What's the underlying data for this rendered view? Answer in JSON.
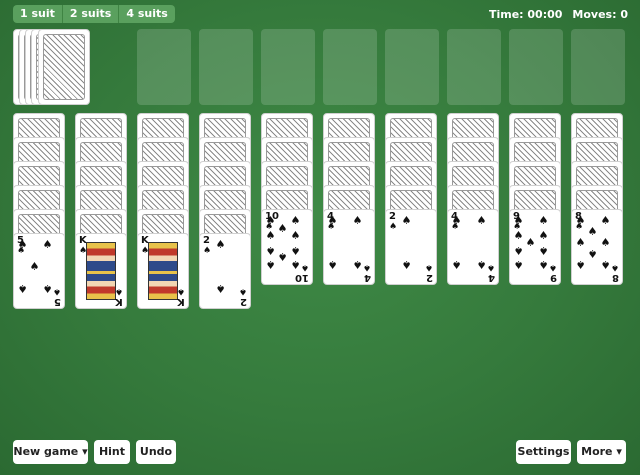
{
  "suits": {
    "one": "1 suit",
    "two": "2 suits",
    "four": "4 suits"
  },
  "status": {
    "time": "Time: 00:00",
    "moves": "Moves: 0"
  },
  "tableau_top": [
    {
      "rank": "5",
      "suit": "♠"
    },
    {
      "rank": "K",
      "suit": "♠"
    },
    {
      "rank": "K",
      "suit": "♠"
    },
    {
      "rank": "2",
      "suit": "♠"
    },
    {
      "rank": "10",
      "suit": "♠"
    },
    {
      "rank": "4",
      "suit": "♠"
    },
    {
      "rank": "2",
      "suit": "♠"
    },
    {
      "rank": "4",
      "suit": "♠"
    },
    {
      "rank": "9",
      "suit": "♠"
    },
    {
      "rank": "8",
      "suit": "♠"
    }
  ],
  "buttons": {
    "new_game": "New game ▾",
    "hint": "Hint",
    "undo": "Undo",
    "settings": "Settings",
    "more": "More ▾"
  }
}
